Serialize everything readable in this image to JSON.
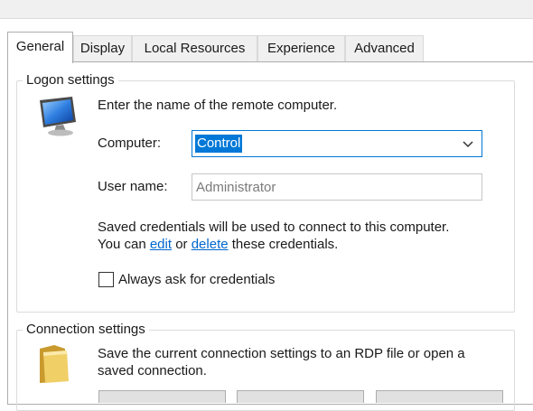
{
  "tabs": [
    {
      "label": "General",
      "active": true
    },
    {
      "label": "Display",
      "active": false
    },
    {
      "label": "Local Resources",
      "active": false
    },
    {
      "label": "Experience",
      "active": false
    },
    {
      "label": "Advanced",
      "active": false
    }
  ],
  "logon": {
    "legend": "Logon settings",
    "intro": "Enter the name of the remote computer.",
    "computer_label": "Computer:",
    "computer_value": "Control",
    "username_label": "User name:",
    "username_value": "Administrator",
    "saved_line1": "Saved credentials will be used to connect to this computer.",
    "saved_line2_prefix": "You can",
    "edit_link": "edit",
    "or_text": "or",
    "delete_link": "delete",
    "saved_line2_suffix": "these credentials.",
    "always_ask_label": "Always ask for credentials",
    "always_ask_checked": false
  },
  "connection": {
    "legend": "Connection settings",
    "line1": "Save the current connection settings to an RDP file or open a",
    "line2": "saved connection."
  },
  "icons": {
    "computer": "monitor-icon",
    "folder": "folder-icon",
    "dropdown": "chevron-down-icon"
  },
  "colors": {
    "accent": "#0078d7",
    "link": "#0066cc"
  }
}
